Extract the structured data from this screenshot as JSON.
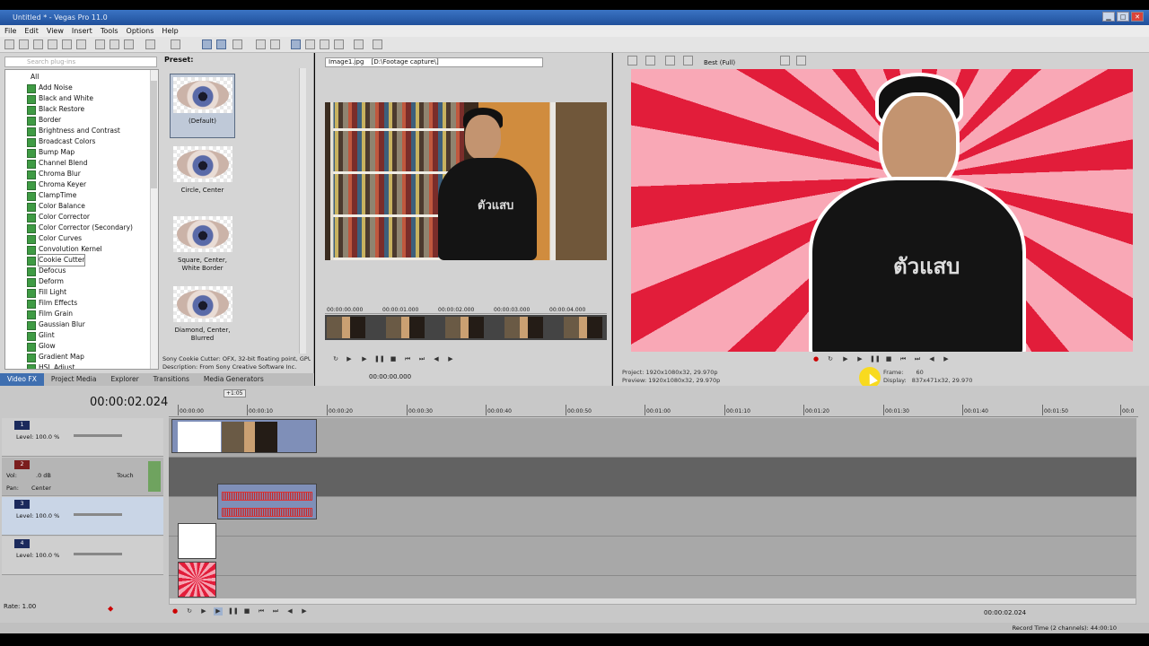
{
  "window": {
    "title": "Untitled * - Vegas Pro 11.0",
    "min": "▁",
    "max": "□",
    "close": "✕"
  },
  "menu": [
    "File",
    "Edit",
    "View",
    "Insert",
    "Tools",
    "Options",
    "Help"
  ],
  "fx": {
    "search_placeholder": "Search plug-ins",
    "root": "All",
    "items": [
      "Add Noise",
      "Black and White",
      "Black Restore",
      "Border",
      "Brightness and Contrast",
      "Broadcast Colors",
      "Bump Map",
      "Channel Blend",
      "Chroma Blur",
      "Chroma Keyer",
      "ClampTime",
      "Color Balance",
      "Color Corrector",
      "Color Corrector (Secondary)",
      "Color Curves",
      "Convolution Kernel",
      "Cookie Cutter",
      "Defocus",
      "Deform",
      "Fill Light",
      "Film Effects",
      "Film Grain",
      "Gaussian Blur",
      "Glint",
      "Glow",
      "Gradient Map",
      "HSL Adjust"
    ],
    "selected": "Cookie Cutter",
    "preset_label": "Preset:",
    "presets": [
      "(Default)",
      "Circle, Center",
      "Square, Center, White Border",
      "Diamond, Center, Blurred"
    ],
    "desc1": "Sony Cookie Cutter: OFX, 32-bit floating point, GPU",
    "desc2": "Description: From Sony Creative Software Inc.",
    "tabs": [
      "Video FX",
      "Project Media",
      "Explorer",
      "Transitions",
      "Media Generators"
    ]
  },
  "trimmer": {
    "file": "Image1.jpg",
    "path": "[D:\\Footage capture\\]",
    "ruler": [
      "00:00:00.000",
      "00:00:01.000",
      "00:00:02.000",
      "00:00:03.000",
      "00:00:04.000"
    ],
    "timecode": "00:00:00.000",
    "shirt_text": "ตัวแสบ"
  },
  "preview": {
    "quality": "Best (Full)",
    "project": "Project:  1920x1080x32, 29.970p",
    "preview": "Preview:  1920x1080x32, 29.970p",
    "frame_label": "Frame:",
    "frame": "60",
    "display_label": "Display:",
    "display": "837x471x32, 29.970",
    "shirt_text": "ตัวแสบ"
  },
  "timeline": {
    "time": "00:00:02.024",
    "playhead_badge": "+1:05",
    "ruler": [
      "00:00:00",
      "00:00:10",
      "00:00:20",
      "00:00:30",
      "00:00:40",
      "00:00:50",
      "00:01:00",
      "00:01:10",
      "00:01:20",
      "00:01:30",
      "00:01:40",
      "00:01:50",
      "00:0"
    ],
    "tracks": [
      {
        "num": "1",
        "label": "Level: 100.0 %"
      },
      {
        "num": "2",
        "vol": "Vol:",
        "vol_val": ".0 dB",
        "pan": "Pan:",
        "pan_val": "Center",
        "touch": "Touch"
      },
      {
        "num": "3",
        "label": "Level: 100.0 %"
      },
      {
        "num": "4",
        "label": "Level: 100.0 %"
      }
    ],
    "rate": "Rate: 1.00",
    "cursor_time": "00:00:02.024",
    "status": "Record Time (2 channels): 44:00:10"
  },
  "colors": {
    "accent": "#3f6fb0",
    "burst_red": "#e21d3a",
    "burst_pink": "#f9a8b6",
    "titlebar": "#2a5ea8"
  }
}
